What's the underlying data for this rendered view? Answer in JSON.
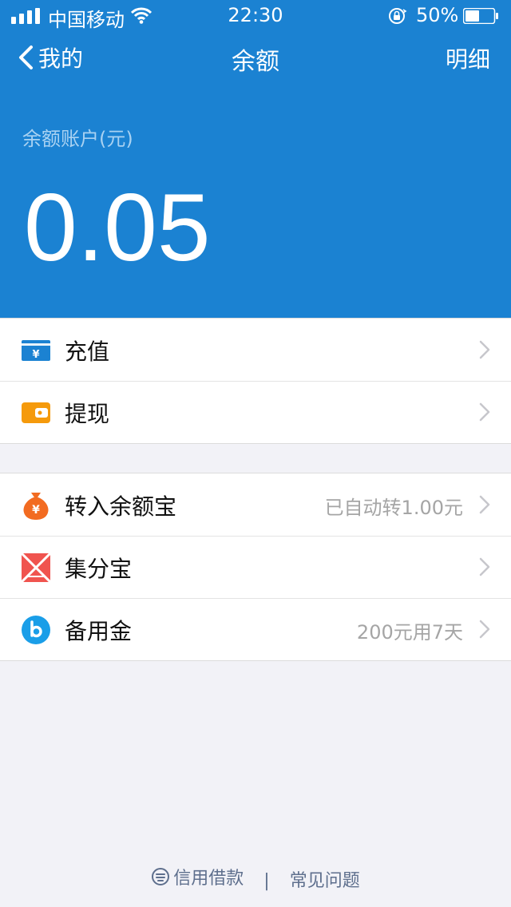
{
  "status_bar": {
    "carrier": "中国移动",
    "time": "22:30",
    "battery": "50%"
  },
  "nav": {
    "back_label": "我的",
    "title": "余额",
    "detail_label": "明细"
  },
  "balance": {
    "label": "余额账户(元)",
    "value": "0.05"
  },
  "group1": [
    {
      "label": "充值",
      "icon": "recharge-icon"
    },
    {
      "label": "提现",
      "icon": "wallet-icon"
    }
  ],
  "group2": [
    {
      "label": "转入余额宝",
      "value": "已自动转1.00元",
      "icon": "money-bag-icon"
    },
    {
      "label": "集分宝",
      "value": "",
      "icon": "jifenbao-icon"
    },
    {
      "label": "备用金",
      "value": "200元用7天",
      "icon": "beiyongjin-icon"
    }
  ],
  "footer": {
    "credit_loan": "信用借款",
    "separator": "|",
    "faq": "常见问题"
  },
  "colors": {
    "primary": "#1b82d2",
    "recharge": "#1b82d2",
    "wallet": "#f59a0c",
    "money_bag": "#f26b21",
    "jifenbao": "#f0544f",
    "beiyongjin": "#1a9ee8"
  }
}
